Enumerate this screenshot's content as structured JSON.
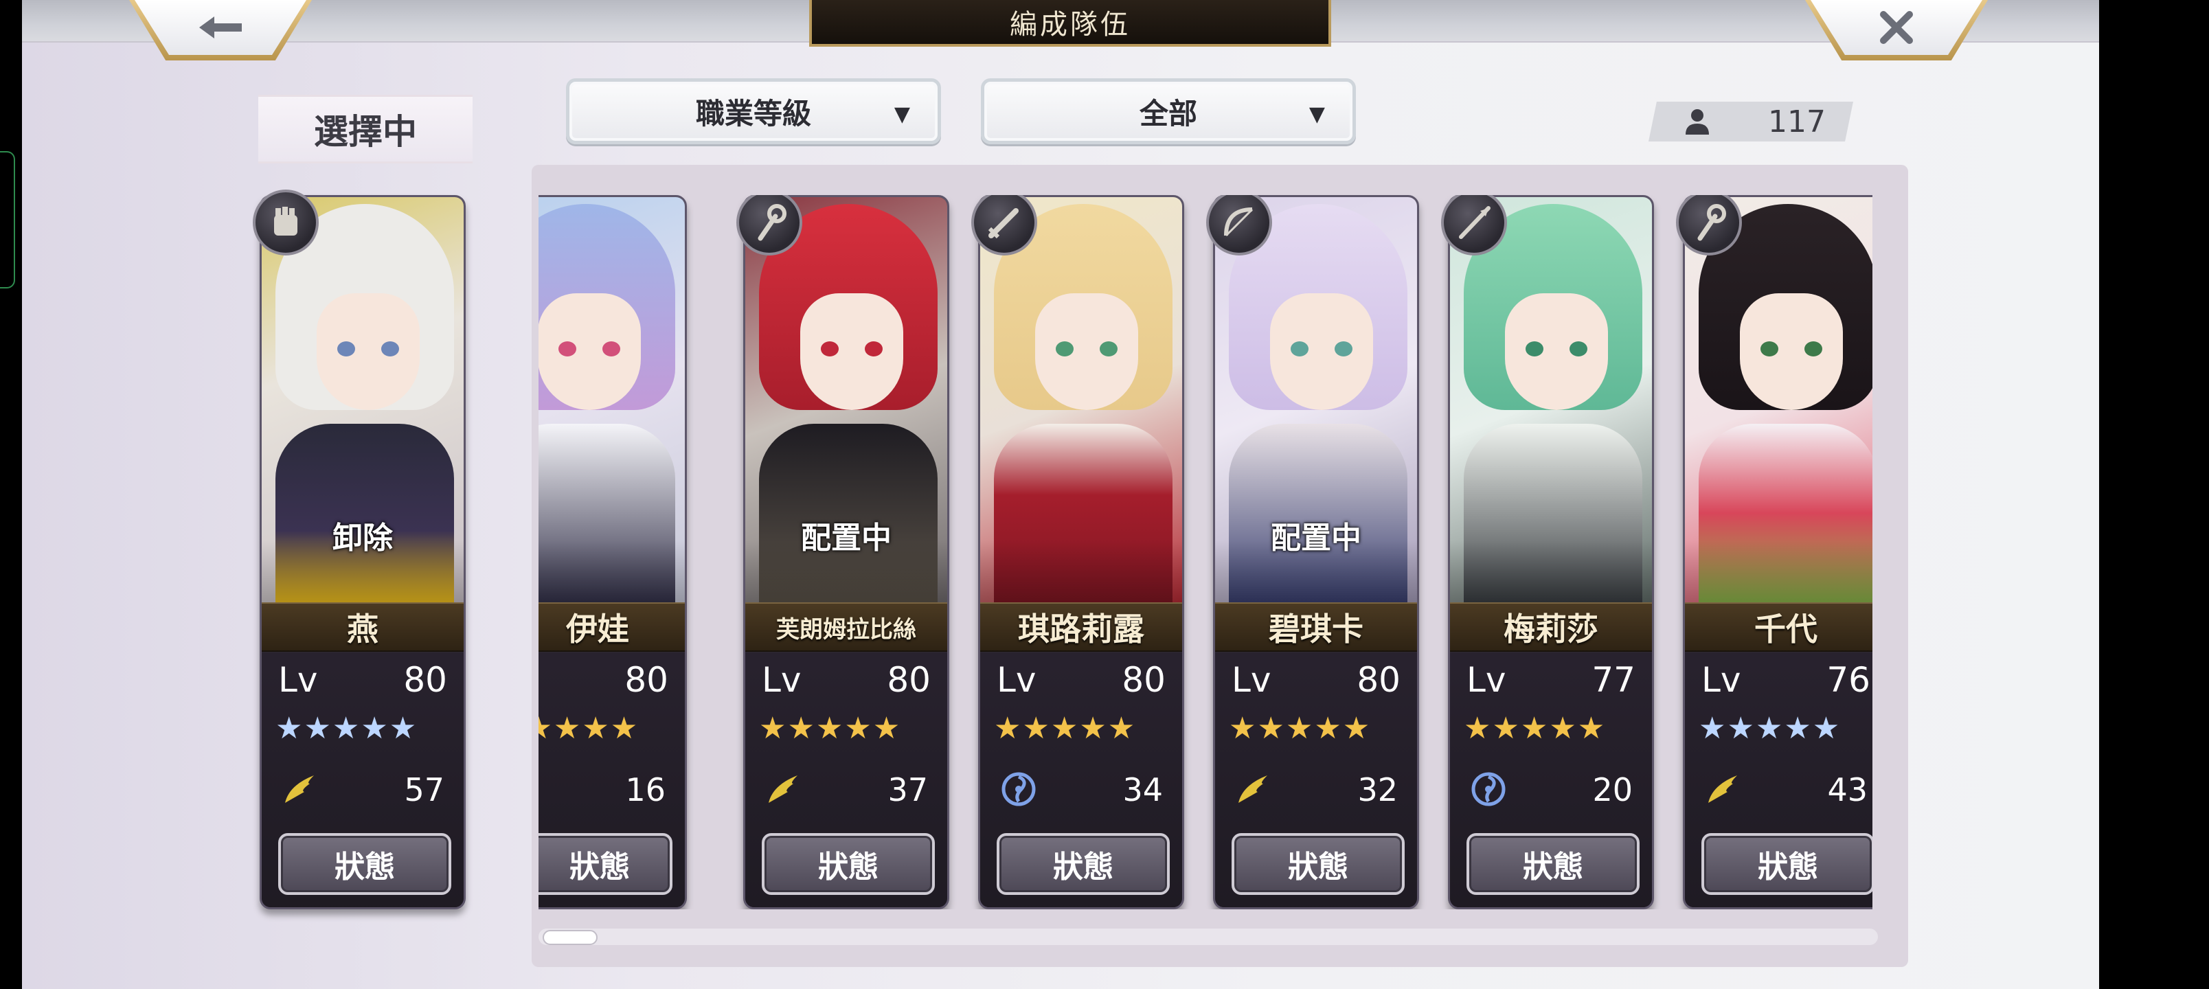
{
  "header": {
    "title": "編成隊伍",
    "back_icon": "arrow-left-icon",
    "close_icon": "close-x-icon"
  },
  "selected_label": "選擇中",
  "filters": {
    "class_dropdown": {
      "label": "職業等級"
    },
    "scope_dropdown": {
      "label": "全部"
    }
  },
  "unit_count": {
    "icon": "person-icon",
    "value": "117"
  },
  "selected_unit": {
    "name": "燕",
    "lv_label": "Lv",
    "level": "80",
    "stars": "★★★★★",
    "star_color": "#bcd6ff",
    "overlay": "卸除",
    "element_icon": "wing-icon",
    "power": "57",
    "button": "狀態",
    "class_icon": "gauntlet-icon"
  },
  "roster": [
    {
      "name": "伊娃",
      "lv_label": "Lv",
      "level": "80",
      "stars": "★★★★★",
      "star_color": "#f3c24a",
      "overlay": "",
      "element_icon": "wing-icon",
      "power": "16",
      "button": "狀態",
      "class_icon": ""
    },
    {
      "name": "芙朗姆拉比絲",
      "lv_label": "Lv",
      "level": "80",
      "stars": "★★★★★",
      "star_color": "#f3c24a",
      "overlay": "配置中",
      "element_icon": "wing-icon",
      "power": "37",
      "button": "狀態",
      "class_icon": "staff-icon"
    },
    {
      "name": "琪路莉露",
      "lv_label": "Lv",
      "level": "80",
      "stars": "★★★★★",
      "star_color": "#f3c24a",
      "overlay": "",
      "element_icon": "swirl-icon",
      "power": "34",
      "button": "狀態",
      "class_icon": "sword-icon"
    },
    {
      "name": "碧琪卡",
      "lv_label": "Lv",
      "level": "80",
      "stars": "★★★★★",
      "star_color": "#f3c24a",
      "overlay": "配置中",
      "element_icon": "wing-icon",
      "power": "32",
      "button": "狀態",
      "class_icon": "bow-icon"
    },
    {
      "name": "梅莉莎",
      "lv_label": "Lv",
      "level": "77",
      "stars": "★★★★★",
      "star_color": "#f3c24a",
      "overlay": "",
      "element_icon": "swirl-icon",
      "power": "20",
      "button": "狀態",
      "class_icon": "lance-icon"
    },
    {
      "name": "千代",
      "lv_label": "Lv",
      "level": "76",
      "stars": "★★★★★",
      "star_color": "#bcd6ff",
      "overlay": "",
      "element_icon": "wing-icon",
      "power": "43",
      "button": "狀態",
      "class_icon": "staff-icon"
    }
  ],
  "colors": {
    "gold_frame": "#b9954d",
    "name_band": "#4b3a22",
    "card_bg": "#2b2530"
  }
}
